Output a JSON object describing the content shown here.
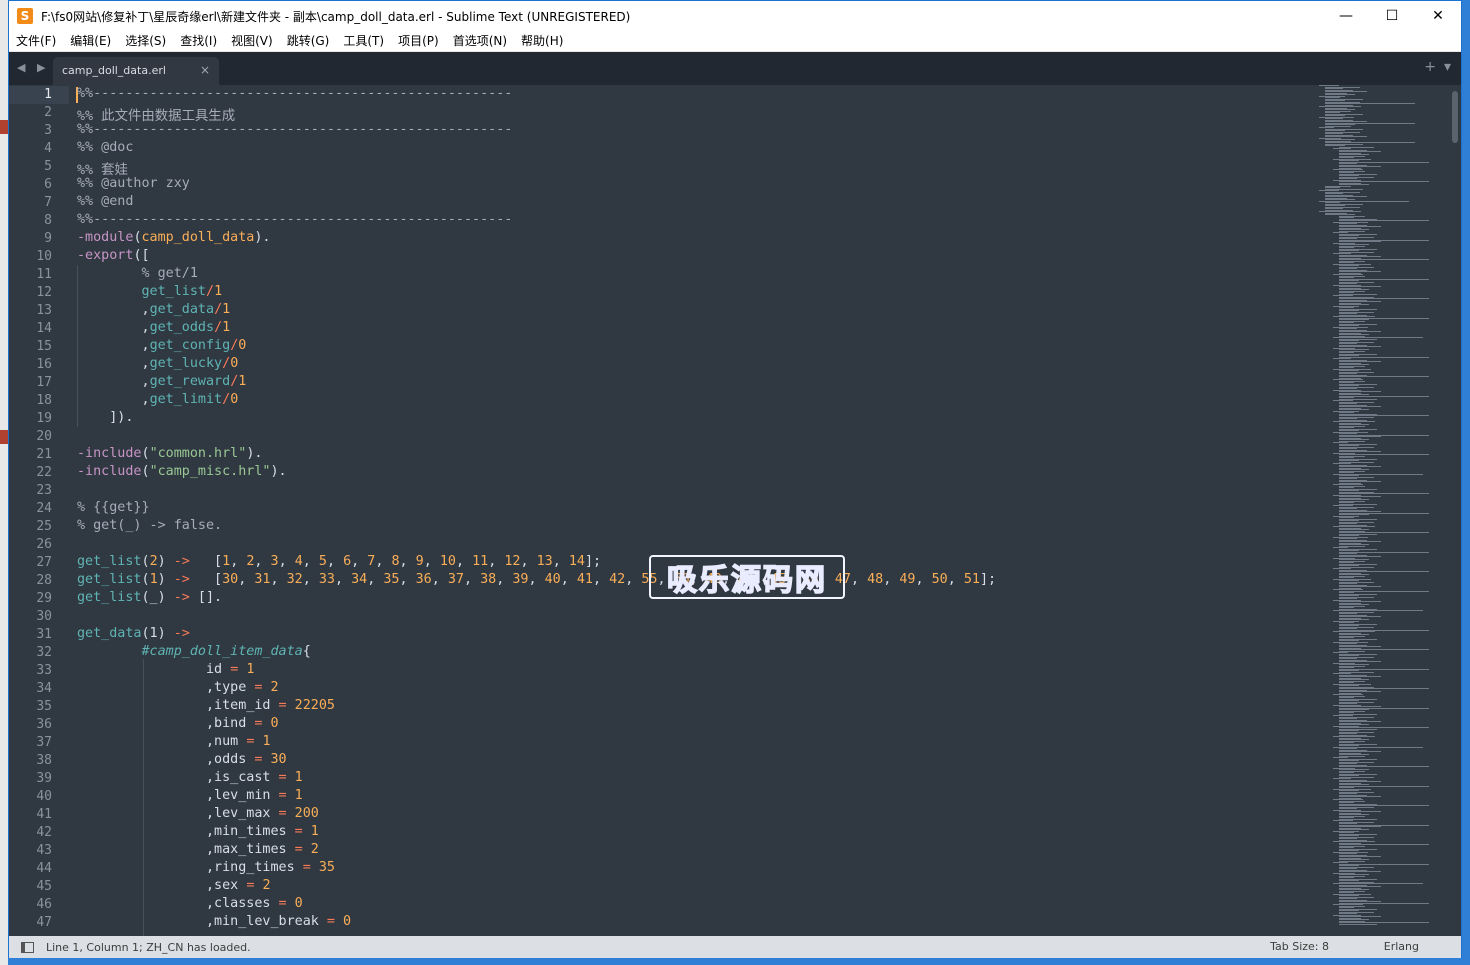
{
  "window": {
    "title": "F:\\fs0网站\\修复补丁\\星辰奇缘erl\\新建文件夹 - 副本\\camp_doll_data.erl - Sublime Text (UNREGISTERED)",
    "app_icon": "sublime-icon",
    "controls": {
      "minimize": "—",
      "maximize": "☐",
      "close": "✕"
    }
  },
  "menu": [
    "文件(F)",
    "编辑(E)",
    "选择(S)",
    "查找(I)",
    "视图(V)",
    "跳转(G)",
    "工具(T)",
    "项目(P)",
    "首选项(N)",
    "帮助(H)"
  ],
  "tabs": {
    "nav_arrows": "◀ ▶",
    "active": {
      "label": "camp_doll_data.erl",
      "close": "×"
    },
    "tools": {
      "new": "+",
      "dropdown": "▾"
    }
  },
  "editor": {
    "current_line": 1,
    "line_numbers": [
      "1",
      "2",
      "3",
      "4",
      "5",
      "6",
      "7",
      "8",
      "9",
      "10",
      "11",
      "12",
      "13",
      "14",
      "15",
      "16",
      "17",
      "18",
      "19",
      "20",
      "21",
      "22",
      "23",
      "24",
      "25",
      "26",
      "27",
      "28",
      "29",
      "30",
      "31",
      "32",
      "33",
      "34",
      "35",
      "36",
      "37",
      "38",
      "39",
      "40",
      "41",
      "42",
      "43",
      "44",
      "45",
      "46",
      "47"
    ],
    "lines": [
      [
        [
          "c",
          "%%----------------------------------------------------"
        ]
      ],
      [
        [
          "c",
          "%% 此文件由数据工具生成"
        ]
      ],
      [
        [
          "c",
          "%%----------------------------------------------------"
        ]
      ],
      [
        [
          "c",
          "%% @doc"
        ]
      ],
      [
        [
          "c",
          "%% 套娃"
        ]
      ],
      [
        [
          "c",
          "%% @author zxy"
        ]
      ],
      [
        [
          "c",
          "%% @end"
        ]
      ],
      [
        [
          "c",
          "%%----------------------------------------------------"
        ]
      ],
      [
        [
          "k",
          "-module"
        ],
        [
          "p",
          "("
        ],
        [
          "n",
          "camp_doll_data"
        ],
        [
          "p",
          ")."
        ]
      ],
      [
        [
          "k",
          "-export"
        ],
        [
          "p",
          "(["
        ]
      ],
      [
        [
          "p",
          "        "
        ],
        [
          "c",
          "% get/1"
        ]
      ],
      [
        [
          "p",
          "        "
        ],
        [
          "f",
          "get_list"
        ],
        [
          "o",
          "/"
        ],
        [
          "n",
          "1"
        ]
      ],
      [
        [
          "p",
          "        ,"
        ],
        [
          "f",
          "get_data"
        ],
        [
          "o",
          "/"
        ],
        [
          "n",
          "1"
        ]
      ],
      [
        [
          "p",
          "        ,"
        ],
        [
          "f",
          "get_odds"
        ],
        [
          "o",
          "/"
        ],
        [
          "n",
          "1"
        ]
      ],
      [
        [
          "p",
          "        ,"
        ],
        [
          "f",
          "get_config"
        ],
        [
          "o",
          "/"
        ],
        [
          "n",
          "0"
        ]
      ],
      [
        [
          "p",
          "        ,"
        ],
        [
          "f",
          "get_lucky"
        ],
        [
          "o",
          "/"
        ],
        [
          "n",
          "0"
        ]
      ],
      [
        [
          "p",
          "        ,"
        ],
        [
          "f",
          "get_reward"
        ],
        [
          "o",
          "/"
        ],
        [
          "n",
          "1"
        ]
      ],
      [
        [
          "p",
          "        ,"
        ],
        [
          "f",
          "get_limit"
        ],
        [
          "o",
          "/"
        ],
        [
          "n",
          "0"
        ]
      ],
      [
        [
          "p",
          "    ])."
        ]
      ],
      [
        [
          "p",
          ""
        ]
      ],
      [
        [
          "k",
          "-include"
        ],
        [
          "p",
          "("
        ],
        [
          "s",
          "\"common.hrl\""
        ],
        [
          "p",
          ")."
        ]
      ],
      [
        [
          "k",
          "-include"
        ],
        [
          "p",
          "("
        ],
        [
          "s",
          "\"camp_misc.hrl\""
        ],
        [
          "p",
          ")."
        ]
      ],
      [
        [
          "p",
          ""
        ]
      ],
      [
        [
          "c",
          "% {{get}}"
        ]
      ],
      [
        [
          "c",
          "% get(_) -> false."
        ]
      ],
      [
        [
          "p",
          ""
        ]
      ],
      [
        [
          "f",
          "get_list"
        ],
        [
          "p",
          "("
        ],
        [
          "n",
          "2"
        ],
        [
          "p",
          ") "
        ],
        [
          "o",
          "->"
        ],
        [
          "p",
          "   ["
        ],
        [
          "n",
          "1"
        ],
        [
          "p",
          ", "
        ],
        [
          "n",
          "2"
        ],
        [
          "p",
          ", "
        ],
        [
          "n",
          "3"
        ],
        [
          "p",
          ", "
        ],
        [
          "n",
          "4"
        ],
        [
          "p",
          ", "
        ],
        [
          "n",
          "5"
        ],
        [
          "p",
          ", "
        ],
        [
          "n",
          "6"
        ],
        [
          "p",
          ", "
        ],
        [
          "n",
          "7"
        ],
        [
          "p",
          ", "
        ],
        [
          "n",
          "8"
        ],
        [
          "p",
          ", "
        ],
        [
          "n",
          "9"
        ],
        [
          "p",
          ", "
        ],
        [
          "n",
          "10"
        ],
        [
          "p",
          ", "
        ],
        [
          "n",
          "11"
        ],
        [
          "p",
          ", "
        ],
        [
          "n",
          "12"
        ],
        [
          "p",
          ", "
        ],
        [
          "n",
          "13"
        ],
        [
          "p",
          ", "
        ],
        [
          "n",
          "14"
        ],
        [
          "p",
          "];"
        ]
      ],
      [
        [
          "f",
          "get_list"
        ],
        [
          "p",
          "("
        ],
        [
          "n",
          "1"
        ],
        [
          "p",
          ") "
        ],
        [
          "o",
          "->"
        ],
        [
          "p",
          "   ["
        ],
        [
          "n",
          "30"
        ],
        [
          "p",
          ", "
        ],
        [
          "n",
          "31"
        ],
        [
          "p",
          ", "
        ],
        [
          "n",
          "32"
        ],
        [
          "p",
          ", "
        ],
        [
          "n",
          "33"
        ],
        [
          "p",
          ", "
        ],
        [
          "n",
          "34"
        ],
        [
          "p",
          ", "
        ],
        [
          "n",
          "35"
        ],
        [
          "p",
          ", "
        ],
        [
          "n",
          "36"
        ],
        [
          "p",
          ", "
        ],
        [
          "n",
          "37"
        ],
        [
          "p",
          ", "
        ],
        [
          "n",
          "38"
        ],
        [
          "p",
          ", "
        ],
        [
          "n",
          "39"
        ],
        [
          "p",
          ", "
        ],
        [
          "n",
          "40"
        ],
        [
          "p",
          ", "
        ],
        [
          "n",
          "41"
        ],
        [
          "p",
          ", "
        ],
        [
          "n",
          "42"
        ],
        [
          "p",
          ", "
        ],
        [
          "n",
          "55"
        ],
        [
          "p",
          ", "
        ],
        [
          "n",
          "56"
        ],
        [
          "p",
          ", "
        ],
        [
          "n",
          "43"
        ],
        [
          "p",
          ", "
        ],
        [
          "n",
          "44"
        ],
        [
          "p",
          ", "
        ],
        [
          "n",
          "45"
        ],
        [
          "p",
          ", "
        ],
        [
          "n",
          "46"
        ],
        [
          "p",
          ", "
        ],
        [
          "n",
          "47"
        ],
        [
          "p",
          ", "
        ],
        [
          "n",
          "48"
        ],
        [
          "p",
          ", "
        ],
        [
          "n",
          "49"
        ],
        [
          "p",
          ", "
        ],
        [
          "n",
          "50"
        ],
        [
          "p",
          ", "
        ],
        [
          "n",
          "51"
        ],
        [
          "p",
          "];"
        ]
      ],
      [
        [
          "f",
          "get_list"
        ],
        [
          "p",
          "(_) "
        ],
        [
          "o",
          "->"
        ],
        [
          "p",
          " []."
        ]
      ],
      [
        [
          "p",
          ""
        ]
      ],
      [
        [
          "f",
          "get_data"
        ],
        [
          "p",
          "(1) "
        ],
        [
          "o",
          "->"
        ]
      ],
      [
        [
          "p",
          "        "
        ],
        [
          "r",
          "#camp_doll_item_data"
        ],
        [
          "p",
          "{"
        ]
      ],
      [
        [
          "p",
          "                id "
        ],
        [
          "o",
          "="
        ],
        [
          "p",
          " "
        ],
        [
          "n",
          "1"
        ]
      ],
      [
        [
          "p",
          "                ,type "
        ],
        [
          "o",
          "="
        ],
        [
          "p",
          " "
        ],
        [
          "n",
          "2"
        ]
      ],
      [
        [
          "p",
          "                ,item_id "
        ],
        [
          "o",
          "="
        ],
        [
          "p",
          " "
        ],
        [
          "n",
          "22205"
        ]
      ],
      [
        [
          "p",
          "                ,bind "
        ],
        [
          "o",
          "="
        ],
        [
          "p",
          " "
        ],
        [
          "n",
          "0"
        ]
      ],
      [
        [
          "p",
          "                ,num "
        ],
        [
          "o",
          "="
        ],
        [
          "p",
          " "
        ],
        [
          "n",
          "1"
        ]
      ],
      [
        [
          "p",
          "                ,odds "
        ],
        [
          "o",
          "="
        ],
        [
          "p",
          " "
        ],
        [
          "n",
          "30"
        ]
      ],
      [
        [
          "p",
          "                ,is_cast "
        ],
        [
          "o",
          "="
        ],
        [
          "p",
          " "
        ],
        [
          "n",
          "1"
        ]
      ],
      [
        [
          "p",
          "                ,lev_min "
        ],
        [
          "o",
          "="
        ],
        [
          "p",
          " "
        ],
        [
          "n",
          "1"
        ]
      ],
      [
        [
          "p",
          "                ,lev_max "
        ],
        [
          "o",
          "="
        ],
        [
          "p",
          " "
        ],
        [
          "n",
          "200"
        ]
      ],
      [
        [
          "p",
          "                ,min_times "
        ],
        [
          "o",
          "="
        ],
        [
          "p",
          " "
        ],
        [
          "n",
          "1"
        ]
      ],
      [
        [
          "p",
          "                ,max_times "
        ],
        [
          "o",
          "="
        ],
        [
          "p",
          " "
        ],
        [
          "n",
          "2"
        ]
      ],
      [
        [
          "p",
          "                ,ring_times "
        ],
        [
          "o",
          "="
        ],
        [
          "p",
          " "
        ],
        [
          "n",
          "35"
        ]
      ],
      [
        [
          "p",
          "                ,sex "
        ],
        [
          "o",
          "="
        ],
        [
          "p",
          " "
        ],
        [
          "n",
          "2"
        ]
      ],
      [
        [
          "p",
          "                ,classes "
        ],
        [
          "o",
          "="
        ],
        [
          "p",
          " "
        ],
        [
          "n",
          "0"
        ]
      ],
      [
        [
          "p",
          "                ,min_lev_break "
        ],
        [
          "o",
          "="
        ],
        [
          "p",
          " "
        ],
        [
          "n",
          "0"
        ]
      ]
    ]
  },
  "watermark": {
    "text": "吸乐源码网"
  },
  "statusbar": {
    "message": "Line 1, Column 1; ZH_CN has loaded.",
    "tab_size": "Tab Size: 8",
    "syntax": "Erlang"
  },
  "colors": {
    "editor_bg": "#303841",
    "comment": "#a6acb9",
    "keyword": "#c695c6",
    "function": "#5fb4b4",
    "string": "#99c794",
    "number": "#f9ae58",
    "operator": "#f97b58"
  }
}
